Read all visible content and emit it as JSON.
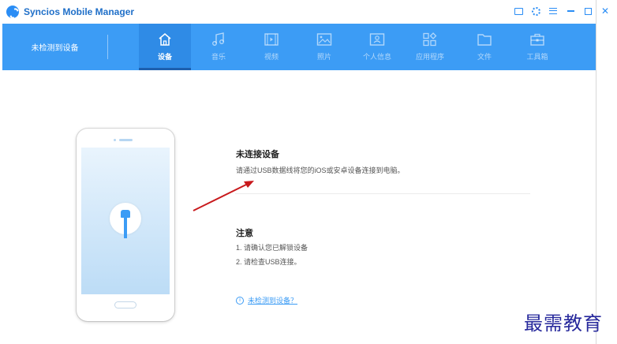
{
  "app": {
    "title": "Syncios Mobile Manager",
    "accent_color": "#3c9cf5",
    "window_controls": [
      "feedback-icon",
      "settings-icon",
      "menu-icon",
      "minimize-icon",
      "maximize-icon",
      "close-icon"
    ]
  },
  "navbar": {
    "device_status": "未检测到设备",
    "active_tab": 0,
    "tabs": [
      {
        "label": "设备",
        "icon": "home-icon"
      },
      {
        "label": "音乐",
        "icon": "music-icon"
      },
      {
        "label": "视频",
        "icon": "video-icon"
      },
      {
        "label": "照片",
        "icon": "photo-icon"
      },
      {
        "label": "个人信息",
        "icon": "contact-icon"
      },
      {
        "label": "应用程序",
        "icon": "apps-icon"
      },
      {
        "label": "文件",
        "icon": "folder-icon"
      },
      {
        "label": "工具箱",
        "icon": "toolbox-icon"
      }
    ]
  },
  "main": {
    "disconnected_title": "未连接设备",
    "disconnected_desc": "请通过USB数据线将您的iOS或安卓设备连接到电脑。",
    "notes_title": "注意",
    "notes": [
      "1. 请确认您已解锁设备",
      "2. 请检查USB连接。"
    ],
    "help_link": "未检测到设备？",
    "help_icon": "info-icon"
  },
  "watermark": "最需教育"
}
